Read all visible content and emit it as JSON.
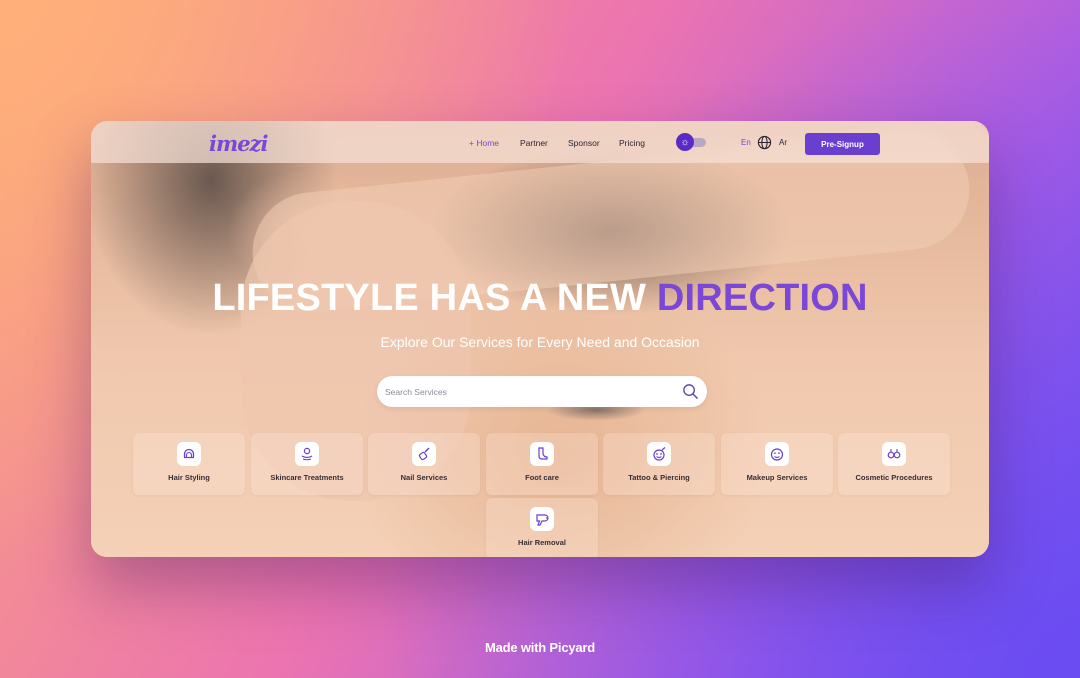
{
  "brand": {
    "logo_text": "imezi",
    "accent_color": "#6a3fcf"
  },
  "nav": {
    "links": [
      {
        "label": "Home",
        "active": true
      },
      {
        "label": "Partner",
        "active": false
      },
      {
        "label": "Sponsor",
        "active": false
      },
      {
        "label": "Pricing",
        "active": false
      }
    ],
    "theme_toggle": {
      "icon": "sun-icon",
      "state": "light"
    },
    "languages": {
      "en": "En",
      "ar": "Ar",
      "icon": "globe-icon"
    },
    "cta_label": "Pre-Signup"
  },
  "hero": {
    "headline_main": "LIFESTYLE HAS A NEW ",
    "headline_accent": "DIRECTION",
    "subtitle": "Explore Our Services for Every Need and Occasion",
    "search": {
      "placeholder": "Search Services",
      "value": "",
      "icon": "search-icon"
    }
  },
  "services": [
    {
      "label": "Hair Styling",
      "icon": "hair-styling-icon"
    },
    {
      "label": "Skincare Treatments",
      "icon": "skincare-icon"
    },
    {
      "label": "Nail Services",
      "icon": "nail-polish-icon"
    },
    {
      "label": "Foot care",
      "icon": "foot-icon"
    },
    {
      "label": "Tattoo & Piercing",
      "icon": "tattoo-icon"
    },
    {
      "label": "Makeup Services",
      "icon": "makeup-icon"
    },
    {
      "label": "Cosmetic Procedures",
      "icon": "cosmetic-icon"
    },
    {
      "label": "Hair Removal",
      "icon": "hair-removal-icon"
    }
  ],
  "footer_note": "Made with Picyard"
}
